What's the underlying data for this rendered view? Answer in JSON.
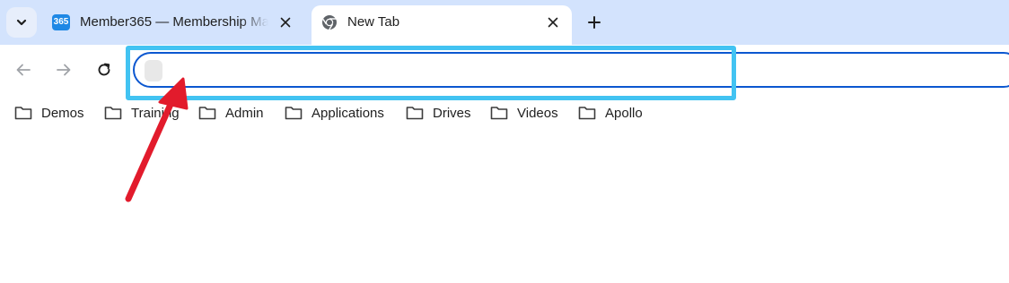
{
  "tabs": [
    {
      "title": "Member365 — Membership Ma",
      "icon_text": "365",
      "active": false
    },
    {
      "title": "New Tab",
      "active": true
    }
  ],
  "icons": {
    "tab_search": "chevron-down-icon",
    "close": "close-icon",
    "new_tab": "plus-icon",
    "back": "arrow-left-icon",
    "forward": "arrow-right-icon",
    "reload": "reload-icon",
    "folder": "folder-icon",
    "chrome": "chrome-icon"
  },
  "omnibox": {
    "value": "",
    "placeholder": ""
  },
  "bookmarks": [
    {
      "label": "Demos"
    },
    {
      "label": "Training"
    },
    {
      "label": "Admin"
    },
    {
      "label": "Applications"
    },
    {
      "label": "Drives"
    },
    {
      "label": "Videos"
    },
    {
      "label": "Apollo"
    }
  ],
  "colors": {
    "tabstrip": "#d3e3fd",
    "omnibox_border": "#0b57d0",
    "highlight": "#42c3f2",
    "annotation_arrow": "#e21b2c"
  }
}
